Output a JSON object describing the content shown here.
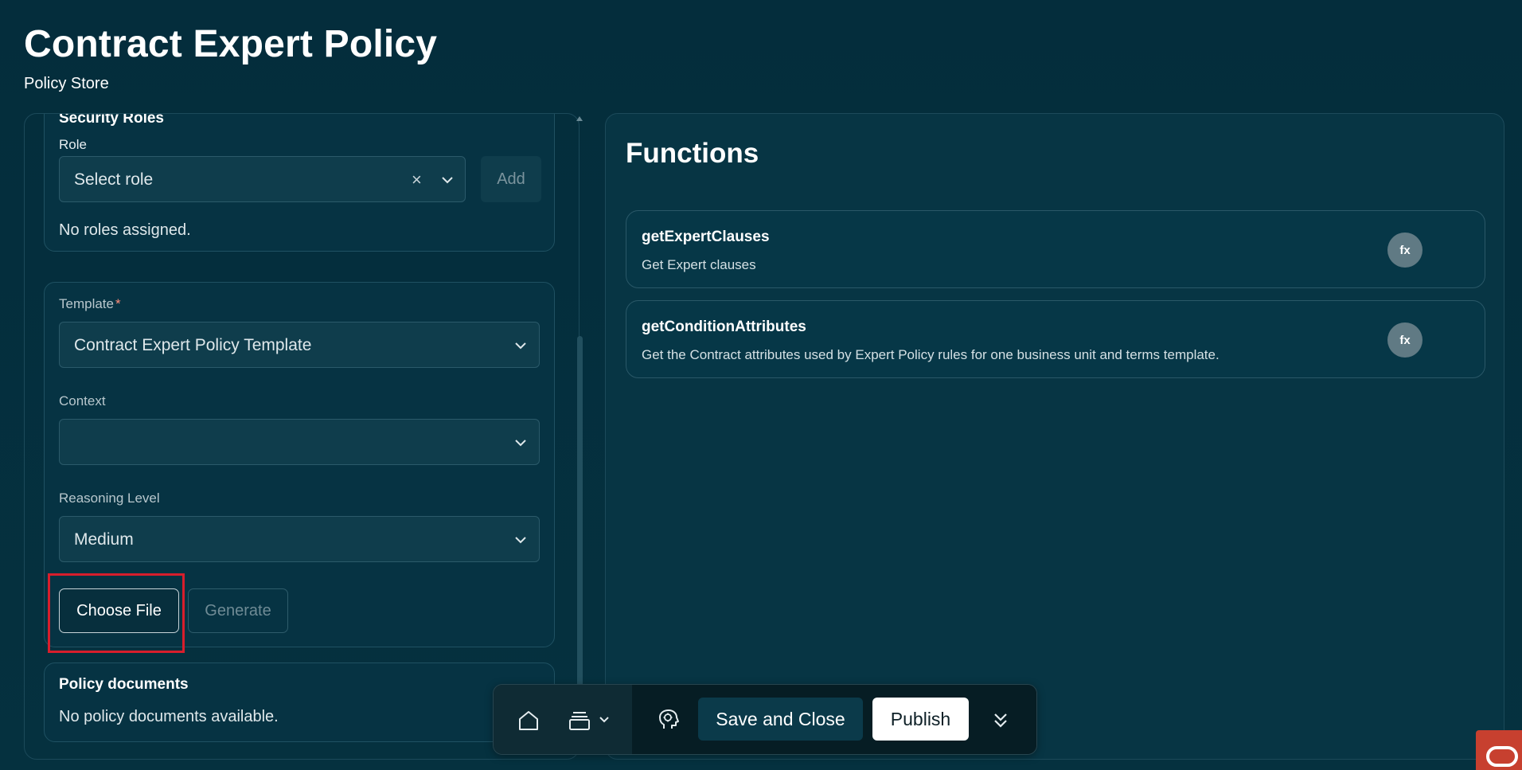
{
  "page": {
    "title": "Contract Expert Policy",
    "subtitle": "Policy Store"
  },
  "roles": {
    "section_title": "Security Roles",
    "role_label": "Role",
    "role_placeholder": "Select role",
    "add_label": "Add",
    "empty_message": "No roles assigned."
  },
  "template_card": {
    "template_label": "Template",
    "template_required": "*",
    "template_value": "Contract Expert Policy Template",
    "context_label": "Context",
    "context_value": "",
    "reasoning_label": "Reasoning Level",
    "reasoning_value": "Medium",
    "choose_file_label": "Choose File",
    "generate_label": "Generate"
  },
  "policy_documents": {
    "title": "Policy documents",
    "empty_message": "No policy documents available."
  },
  "functions": {
    "title": "Functions",
    "items": [
      {
        "name": "getExpertClauses",
        "description": "Get Expert clauses",
        "badge": "fx"
      },
      {
        "name": "getConditionAttributes",
        "description": "Get the Contract attributes used by Expert Policy rules for one business unit and terms template.",
        "badge": "fx"
      }
    ]
  },
  "toolbar": {
    "save_close_label": "Save and Close",
    "publish_label": "Publish"
  },
  "icons": {
    "home": "home-icon",
    "stack": "stack-icon",
    "assistant": "assistant-head-icon",
    "expand": "double-chevron-down-icon",
    "brand": "oracle-logo-icon"
  },
  "colors": {
    "background": "#05303f",
    "highlight": "#d81e2c",
    "publish_bg": "#ffffff",
    "brand_red": "#c7402f"
  }
}
